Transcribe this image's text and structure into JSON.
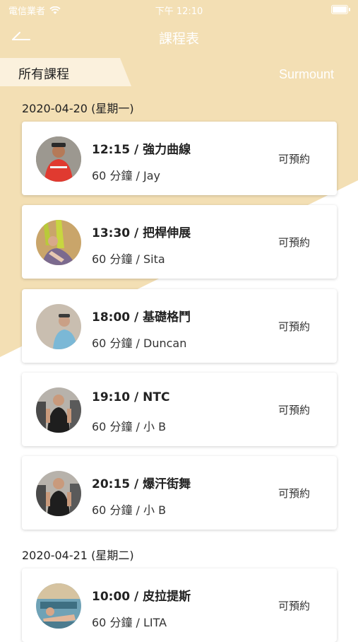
{
  "status_bar": {
    "carrier": "電信業者",
    "time": "下午 12:10"
  },
  "header": {
    "title": "課程表"
  },
  "tabs": {
    "active": "所有課程",
    "brand": "Surmount"
  },
  "sections": [
    {
      "date": "2020-04-20 (星期一)",
      "items": [
        {
          "title": "12:15 / 強力曲線",
          "sub": "60 分鐘 / Jay",
          "status": "可預約"
        },
        {
          "title": "13:30 / 把桿伸展",
          "sub": "60 分鐘 / Sita",
          "status": "可預約"
        },
        {
          "title": "18:00 / 基礎格鬥",
          "sub": "60 分鐘 / Duncan",
          "status": "可預約"
        },
        {
          "title": "19:10 / NTC",
          "sub": "60 分鐘 / 小 B",
          "status": "可預約"
        },
        {
          "title": "20:15 / 爆汗街舞",
          "sub": "60 分鐘 / 小 B",
          "status": "可預約"
        }
      ]
    },
    {
      "date": "2020-04-21 (星期二)",
      "items": [
        {
          "title": "10:00 / 皮拉提斯",
          "sub": "60 分鐘 / LITA",
          "status": "可預約"
        }
      ]
    }
  ]
}
